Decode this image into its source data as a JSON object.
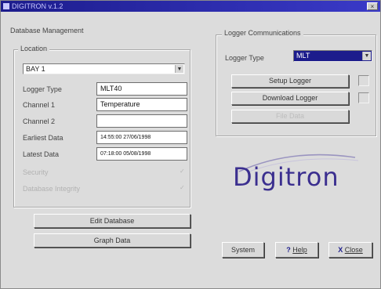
{
  "window": {
    "title": "DIGITRON v.1.2",
    "close_glyph": "×"
  },
  "database": {
    "heading": "Database Management",
    "location_legend": "Location",
    "location_value": "BAY 1",
    "fields": [
      {
        "label": "Logger Type",
        "value": "MLT40"
      },
      {
        "label": "Channel 1",
        "value": "Temperature"
      },
      {
        "label": "Channel 2",
        "value": ""
      },
      {
        "label": "Earliest Data",
        "value": "14:55:00  27/06/1998"
      },
      {
        "label": "Latest Data",
        "value": "07:18:00  05/08/1998"
      }
    ],
    "security_label": "Security",
    "integrity_label": "Database Integrity",
    "check_glyph": "✓",
    "edit_button": "Edit Database",
    "graph_button": "Graph Data"
  },
  "comms": {
    "heading": "Logger Communications",
    "logger_type_label": "Logger Type",
    "logger_type_value": "MLT",
    "setup_button": "Setup Logger",
    "download_button": "Download Logger",
    "file_button": "File Data"
  },
  "logo": {
    "text": "Digitron",
    "color": "#3b2f8f"
  },
  "footer": {
    "system_button": "System",
    "help_key": "?",
    "help_label": "Help",
    "close_key": "X",
    "close_label": "Close"
  },
  "icons": {
    "dropdown": "chevron-down-icon",
    "help": "help-icon",
    "close": "close-icon"
  }
}
